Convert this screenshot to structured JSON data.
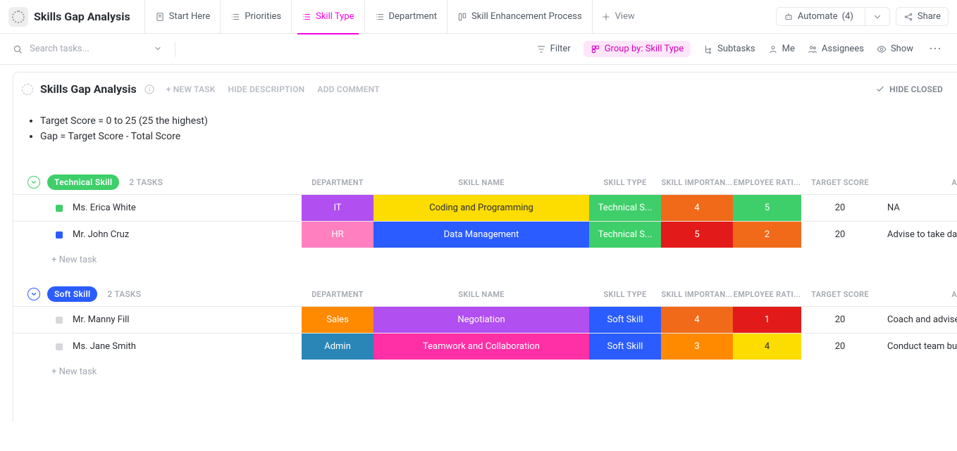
{
  "page": {
    "title": "Skills Gap Analysis"
  },
  "tabs": {
    "items": [
      {
        "label": "Start Here"
      },
      {
        "label": "Priorities"
      },
      {
        "label": "Skill Type"
      },
      {
        "label": "Department"
      },
      {
        "label": "Skill Enhancement Process"
      }
    ],
    "add_view": "View"
  },
  "topbar": {
    "automate_label": "Automate",
    "automate_count": "(4)",
    "share_label": "Share"
  },
  "toolbar": {
    "search_placeholder": "Search tasks...",
    "filter": "Filter",
    "group_by": "Group by: Skill Type",
    "subtasks": "Subtasks",
    "me": "Me",
    "assignees": "Assignees",
    "show": "Show"
  },
  "section": {
    "title": "Skills Gap Analysis",
    "new_task": "+ NEW TASK",
    "hide_description": "HIDE DESCRIPTION",
    "add_comment": "ADD COMMENT",
    "hide_closed": "HIDE CLOSED",
    "bullets": [
      "Target Score = 0 to 25 (25 the highest)",
      "Gap = Target Score - Total Score"
    ]
  },
  "columns": {
    "department": "DEPARTMENT",
    "skill_name": "SKILL NAME",
    "skill_type": "SKILL TYPE",
    "skill_importance": "SKILL IMPORTAN...",
    "employee_rating": "EMPLOYEE RATI...",
    "target_score": "TARGET SCORE",
    "advice_trail": "A"
  },
  "groups": [
    {
      "name": "Technical Skill",
      "pill_color": "#3ecf6a",
      "count_label": "2 TASKS",
      "rows": [
        {
          "status_color": "#3ecf6a",
          "name": "Ms. Erica White",
          "department": {
            "text": "IT",
            "bg": "#b14ff0"
          },
          "skill_name": {
            "text": "Coding and Programming",
            "bg": "#fddc00",
            "fg": "#2a2e34"
          },
          "skill_type": {
            "text": "Technical S...",
            "bg": "#3ecf6a"
          },
          "importance": {
            "text": "4",
            "bg": "#f06a1a"
          },
          "rating": {
            "text": "5",
            "bg": "#3ecf6a"
          },
          "target": "20",
          "advice": "NA"
        },
        {
          "status_color": "#2b5cff",
          "name": "Mr. John Cruz",
          "department": {
            "text": "HR",
            "bg": "#ff7fbf"
          },
          "skill_name": {
            "text": "Data Management",
            "bg": "#2b5cff"
          },
          "skill_type": {
            "text": "Technical S...",
            "bg": "#3ecf6a"
          },
          "importance": {
            "text": "5",
            "bg": "#e21a1a"
          },
          "rating": {
            "text": "2",
            "bg": "#f06a1a"
          },
          "target": "20",
          "advice": "Advise to take data mana"
        }
      ],
      "new_task": "+ New task"
    },
    {
      "name": "Soft Skill",
      "pill_color": "#2b5cff",
      "count_label": "2 TASKS",
      "rows": [
        {
          "status_color": "#d6d7da",
          "name": "Mr. Manny Fill",
          "department": {
            "text": "Sales",
            "bg": "#ff8a00"
          },
          "skill_name": {
            "text": "Negotiation",
            "bg": "#b14ff0"
          },
          "skill_type": {
            "text": "Soft Skill",
            "bg": "#2b5cff"
          },
          "importance": {
            "text": "4",
            "bg": "#f06a1a"
          },
          "rating": {
            "text": "1",
            "bg": "#e21a1a"
          },
          "target": "20",
          "advice": "Coach and advise to take"
        },
        {
          "status_color": "#d6d7da",
          "name": "Ms. Jane Smith",
          "department": {
            "text": "Admin",
            "bg": "#2b86b8"
          },
          "skill_name": {
            "text": "Teamwork and Collaboration",
            "bg": "#ff2fa5"
          },
          "skill_type": {
            "text": "Soft Skill",
            "bg": "#2b5cff"
          },
          "importance": {
            "text": "3",
            "bg": "#ff8a00"
          },
          "rating": {
            "text": "4",
            "bg": "#fddc00",
            "fg": "#2a2e34"
          },
          "target": "20",
          "advice": "Conduct team building ac"
        }
      ],
      "new_task": "+ New task"
    }
  ]
}
